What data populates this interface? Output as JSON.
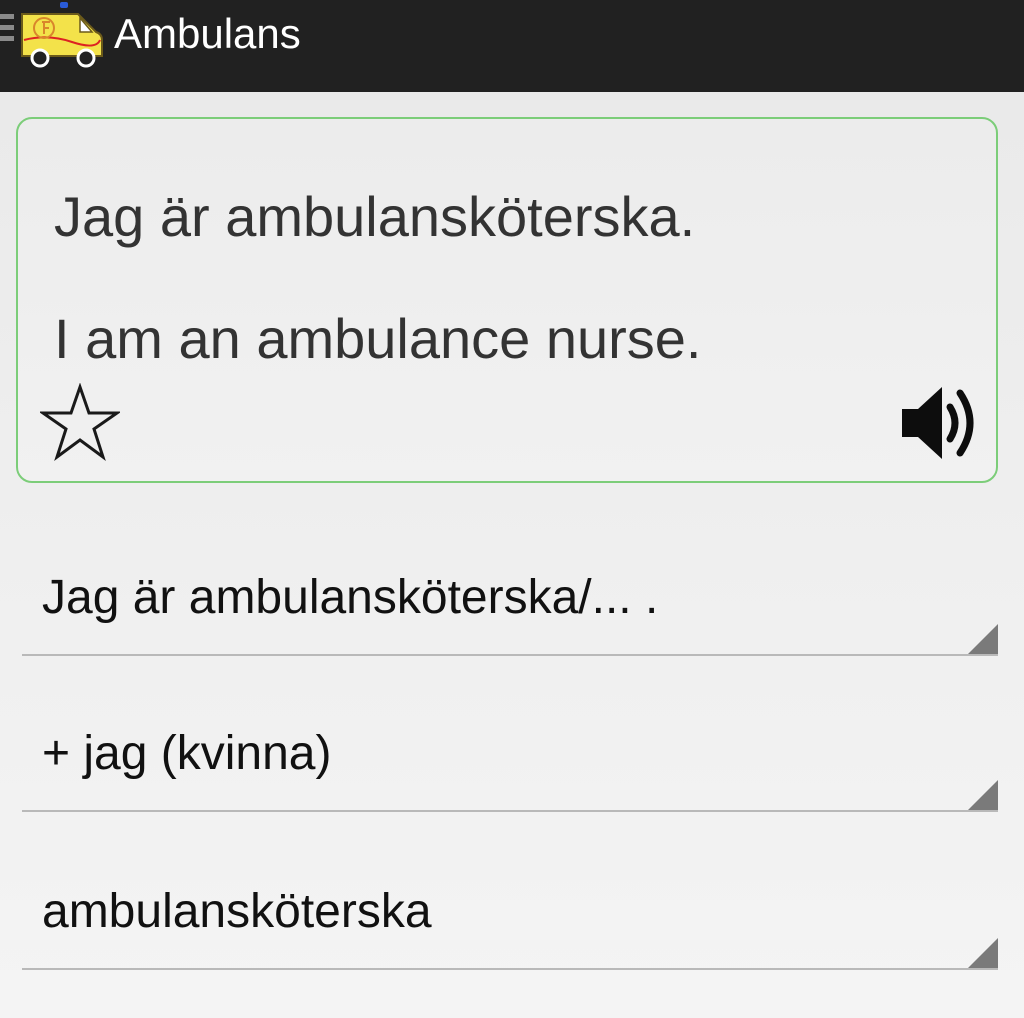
{
  "app_bar": {
    "title": "Ambulans",
    "logo_icon": "ambulance-logo-icon",
    "menu_icon": "drawer-menu-icon",
    "background": "#212121"
  },
  "phrase_card": {
    "swedish": "Jag är ambulansköterska.",
    "english": "I am an ambulance nurse.",
    "favorite_icon": "star-outline-icon",
    "audio_icon": "speaker-icon",
    "border_color": "#7ccd79"
  },
  "spinners": [
    {
      "selected": "Jag är ambulansköterska/... ."
    },
    {
      "selected": "+ jag (kvinna)"
    },
    {
      "selected": "ambulansköterska"
    }
  ]
}
